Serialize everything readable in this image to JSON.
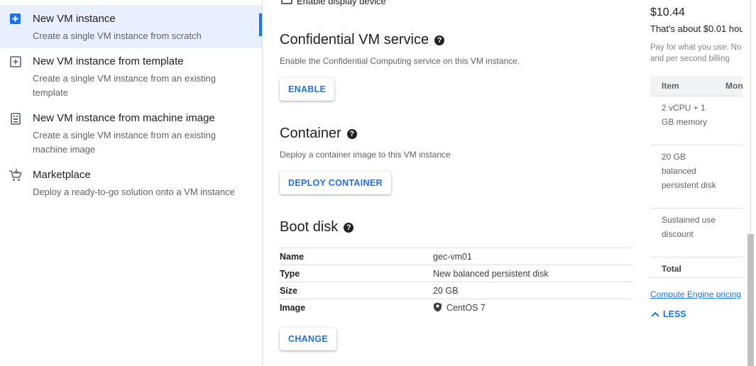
{
  "sidebar": {
    "options": [
      {
        "title": "New VM instance",
        "desc": "Create a single VM instance from scratch",
        "icon": "add-box-icon",
        "selected": true
      },
      {
        "title": "New VM instance from template",
        "desc": "Create a single VM instance from an existing template",
        "icon": "template-add-icon"
      },
      {
        "title": "New VM instance from machine image",
        "desc": "Create a single VM instance from an existing machine image",
        "icon": "machine-image-icon"
      },
      {
        "title": "Marketplace",
        "desc": "Deploy a ready-to-go solution onto a VM instance",
        "icon": "marketplace-cart-icon"
      }
    ]
  },
  "display_device": {
    "label": "Enable display device",
    "checked": false
  },
  "confidential": {
    "title": "Confidential VM service",
    "desc": "Enable the Confidential Computing service on this VM instance.",
    "button": "ENABLE"
  },
  "container": {
    "title": "Container",
    "desc": "Deploy a container image to this VM instance",
    "button": "DEPLOY CONTAINER"
  },
  "boot_disk": {
    "title": "Boot disk",
    "rows": [
      {
        "key": "Name",
        "value": "gec-vm01"
      },
      {
        "key": "Type",
        "value": "New balanced persistent disk"
      },
      {
        "key": "Size",
        "value": "20 GB"
      },
      {
        "key": "Image",
        "value": "CentOS 7"
      }
    ],
    "button": "CHANGE"
  },
  "pricing": {
    "amount": "$10.44",
    "about": "That's about $0.01 hou",
    "note_line1": "Pay for what you use: No",
    "note_line2": "and per second billing",
    "col_item": "Item",
    "col_month": "Mon",
    "rows": [
      "2 vCPU + 1 GB memory",
      "20 GB balanced persistent disk",
      "Sustained use discount"
    ],
    "total": "Total",
    "link": "Compute Engine pricing",
    "less": "LESS"
  },
  "colors": {
    "accent": "#1a73e8",
    "selected_bg": "#e8f0fe"
  }
}
